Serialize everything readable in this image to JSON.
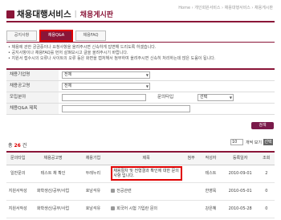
{
  "breadcrumb": "Home › 개인회원서비스 › 채용대행서비스 › 채용게시판",
  "header": {
    "title": "채용대행서비스",
    "separator": "|",
    "subtitle": "채용게시판"
  },
  "tabs": [
    {
      "label": "공지사항"
    },
    {
      "label": "채용Q&A"
    },
    {
      "label": "채용FAQ"
    }
  ],
  "notice": [
    "• 채용에 관한 궁금증이나 요청사항을 올려주시면 신속하게 답변해 드리도록 하겠습니다.",
    "• 공지사항이나 채용FAQ를 먼저 살펴보시고 글을 올려주시기 바랍니다.",
    "• 지원서 접수시의 오류나 사이트의 오류 등은 화면을 캡처해서 첨부하여 올려주시면 신속히 처리하는데 많은 도움이 됩니다."
  ],
  "form": {
    "company_label": "채용기업명",
    "company_value": "전체",
    "posting_label": "채용공고명",
    "posting_value": "전체",
    "field_label": "모집분야",
    "field_value": "",
    "type_label": "문의타입",
    "type_value": "선택",
    "title_label": "채용Q&A 제목",
    "title_value": ""
  },
  "search_button": "검색",
  "total": {
    "prefix": "총",
    "count": "26",
    "suffix": "건"
  },
  "pager": {
    "per_page": "10",
    "per_page_label": "개씩 보기",
    "apply": "선택"
  },
  "table": {
    "headers": [
      "문의타입",
      "채용공고명",
      "채용기업",
      "제목",
      "첨부",
      "작성자",
      "등록일자",
      "조회"
    ],
    "rows": [
      {
        "type": "일반문의",
        "posting": "테스트 채 확인",
        "company": "두레누리",
        "subject": "채용절차 및 전형결과 확인에 대한 문의사항 입니다.",
        "attach": "",
        "author": "테스트",
        "date": "2010-09-01",
        "views": "2"
      },
      {
        "type": "지원서작성",
        "posting": "화학생산/공무/사업",
        "company": "호남석유",
        "subject": "전공관련",
        "attach": "",
        "author": "한영옥",
        "date": "2010-05-01",
        "views": "0"
      },
      {
        "type": "지원서작성",
        "posting": "화학생산/공무/사업",
        "company": "호남석유",
        "subject": "회국어 시험 기입란 문의",
        "attach": "",
        "author": "강은혜",
        "date": "2010-05-28",
        "views": "0"
      }
    ]
  }
}
